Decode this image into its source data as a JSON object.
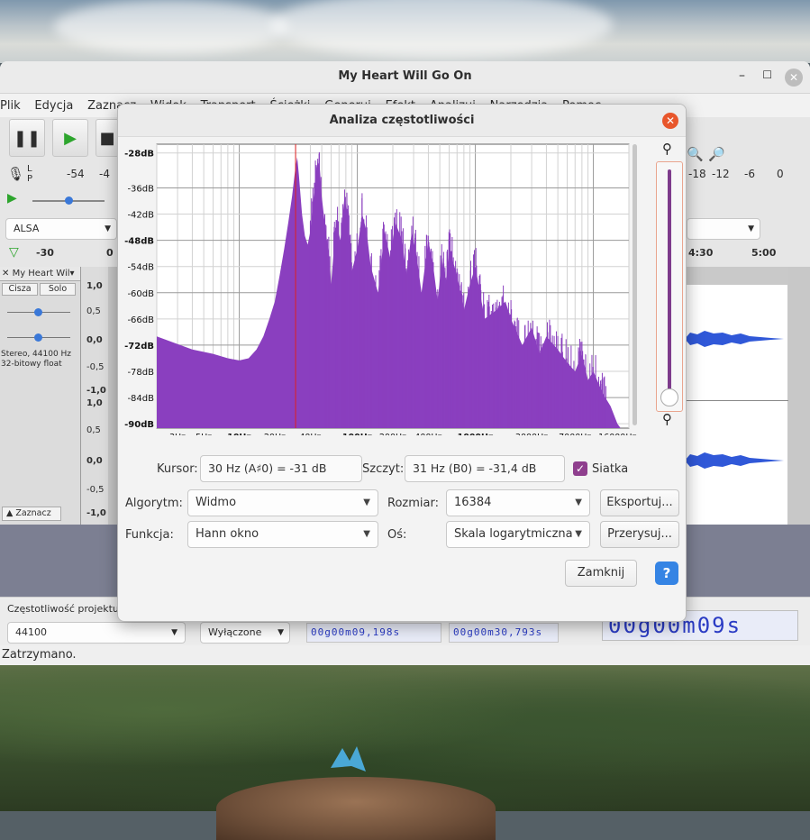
{
  "window": {
    "title": "My Heart Will Go On",
    "menu": [
      "Plik",
      "Edycja",
      "Zaznacz",
      "Widok",
      "Transport",
      "Ścieżki",
      "Generuj",
      "Efekt",
      "Analizuj",
      "Narzędzia",
      "Pomoc"
    ],
    "meter_labels": [
      "-54",
      "-4",
      "-18",
      "-12",
      "-6",
      "0"
    ],
    "audio_host": "ALSA",
    "timeline_ticks": [
      "-30",
      "0",
      "4:30",
      "5:00"
    ],
    "track": {
      "name": "My Heart Wil",
      "mute": "Cisza",
      "solo": "Solo",
      "info_line1": "Stereo, 44100 Hz",
      "info_line2": "32-bitowy float",
      "select_button": "Zaznacz",
      "scale": [
        "1,0",
        "0,5",
        "0,0",
        "-0,5",
        "-1,0",
        "1,0",
        "0,5",
        "0,0",
        "-0,5",
        "-1,0"
      ]
    },
    "bottom": {
      "project_rate_label": "Częstotliwość projektu",
      "project_rate_value": "44100",
      "snap_value": "Wyłączone",
      "sel_start": "00g00m09,198s",
      "sel_end": "00g00m30,793s",
      "big_time": "00g00m09s"
    },
    "status": "Zatrzymano."
  },
  "dialog": {
    "title": "Analiza częstotliwości",
    "db_labels": [
      "-28dB",
      "-36dB",
      "-42dB",
      "-48dB",
      "-54dB",
      "-60dB",
      "-66dB",
      "-72dB",
      "-78dB",
      "-84dB",
      "-90dB"
    ],
    "freq_labels": [
      "3Hz",
      "5Hz",
      "10Hz",
      "20Hz",
      "40Hz",
      "100Hz",
      "200Hz",
      "400Hz",
      "1000Hz",
      "3000Hz",
      "7000Hz",
      "16000Hz"
    ],
    "cursor_label": "Kursor:",
    "cursor_value": "30 Hz (A♯0) = -31 dB",
    "peak_label": "Szczyt:",
    "peak_value": "31 Hz (B0) = -31,4 dB",
    "grid_label": "Siatka",
    "grid_checked": true,
    "algorithm_label": "Algorytm:",
    "algorithm_value": "Widmo",
    "size_label": "Rozmiar:",
    "size_value": "16384",
    "export_button": "Eksportuj...",
    "function_label": "Funkcja:",
    "function_value": "Hann okno",
    "axis_label": "Oś:",
    "axis_value": "Skala logarytmiczna",
    "replot_button": "Przerysuj...",
    "close_button": "Zamknij",
    "help_button": "?",
    "spectrum_color": "#8a3fbf",
    "cursor_line_color": "#e02020"
  }
}
